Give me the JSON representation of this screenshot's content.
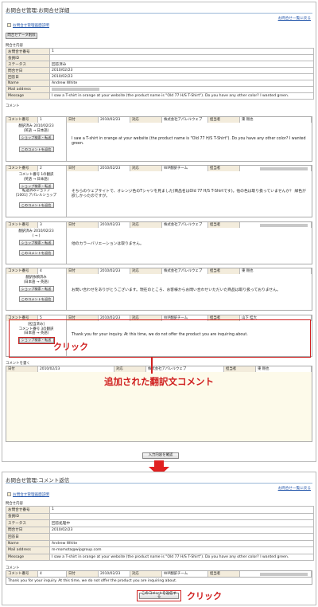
{
  "detail": {
    "title": "お問合せ管理:お問合せ詳細",
    "back_link": "お問合せ一覧に戻る",
    "help_link": "お問合せ管理画面説明",
    "data_button": "問合せデータ削除",
    "section_label": "問合せ内容",
    "fields": [
      {
        "key": "お問合せ番号",
        "value": "1"
      },
      {
        "key": "会員ID",
        "value": ""
      },
      {
        "key": "ステータス",
        "value": "回答済み"
      },
      {
        "key": "問合せ日",
        "value": "2010/02/23"
      },
      {
        "key": "回答日",
        "value": "2010/02/23"
      },
      {
        "key": "Name",
        "value": "Andrew White"
      },
      {
        "key": "Mail address",
        "value": ""
      },
      {
        "key": "Message",
        "value": "I saw a T-shirt in orange at your website (the product name is \"Old 77 H/S T-Shirt\"). Do you have any other color? I wanted green."
      }
    ],
    "comment_label": "コメント",
    "head_labels": {
      "num": "コメント番号",
      "date": "日付",
      "handler": "対応",
      "person": "担当者"
    },
    "comments": [
      {
        "num": "1",
        "date": "2010/02/23",
        "handler": "株式会社アパレルウェブ",
        "person": "東 剛也",
        "left": [
          "翻訳済み 2010/02/23",
          "(英語 → 日本語)"
        ],
        "buttons": [
          "ショップ検索・転送",
          "このコメントを返信"
        ],
        "body": "I saw a T-shirt in orange at your website (the product name is \"Old 77 H/S T-Shirt\"). Do you have any other color? I wanted green."
      },
      {
        "num": "2",
        "date": "2010/02/23",
        "handler": "WIP翻訳チーム",
        "person": "",
        "left": [
          "コメント番号 1の翻訳",
          "(英語 → 日本語)"
        ],
        "buttons": [
          "ショップ検索・転送"
        ],
        "extra": [
          "転送済みショップ",
          "[1001] アパレルショップ"
        ],
        "buttons2": [
          "このコメントを返信"
        ],
        "body": "そちらのウェブサイトで、オレンジ色のTシャツを見ました(商品名はOld 77 H/S T-Shirtです)。他の色は取り扱っていませんか？ 緑色が欲しかったのですが。"
      },
      {
        "num": "3",
        "date": "2010/02/23",
        "handler": "株式会社アパレルウェブ",
        "person": "",
        "left": [
          "翻訳済み 2010/02/23",
          "( → )"
        ],
        "buttons": [
          "ショップ検索・転送",
          "このコメントを返信"
        ],
        "body": "他のカラーバリエーションは取りません。"
      },
      {
        "num": "4",
        "date": "2010/02/23",
        "handler": "株式会社アパレルウェブ",
        "person": "東 剛也",
        "left": [
          "翻訳依頼済み",
          "(日本語 → 英語)"
        ],
        "buttons": [
          "ショップ検索・転送",
          "このコメントを返信"
        ],
        "body": "お問い合わせをありがとうございます。現在のところ、お客様からお問い合わせいただいた商品は取り扱っておりません。"
      },
      {
        "num": "5",
        "date": "2010/02/23",
        "handler": "WIP翻訳チーム",
        "person": "山下 桂大",
        "left": [
          "[担当済み]",
          "コメント番号 3の翻訳",
          "(日本語 → 英語)"
        ],
        "buttons": [
          "ショップ検索・転送"
        ],
        "body": "Thank you for your inquiry. At this time, we do not offer the product you are inquiring about."
      }
    ],
    "new_comment_label": "コメントを書く",
    "new_comment": {
      "date": "2010/02/23",
      "handler": "株式会社アパレルウェブ",
      "person": "東 剛也"
    },
    "confirm_button": "入力内容を確認"
  },
  "annotations": {
    "click1": "クリック",
    "added": "追加された翻訳文コメント",
    "click2": "クリック",
    "accent_color": "#d02020"
  },
  "reply": {
    "title": "お問合せ管理:コメント返信",
    "back_link": "お問合せ一覧に戻る",
    "help_link": "お問合せ管理画面説明",
    "section_label": "問合せ内容",
    "fields": [
      {
        "key": "お問合せ番号",
        "value": "1"
      },
      {
        "key": "会員ID",
        "value": ""
      },
      {
        "key": "ステータス",
        "value": "回答処理中"
      },
      {
        "key": "問合せ日",
        "value": "2010/02/23"
      },
      {
        "key": "回答日",
        "value": ""
      },
      {
        "key": "Name",
        "value": "Andrew White"
      },
      {
        "key": "Mail address",
        "value": "m-momota@wipgroup.com"
      },
      {
        "key": "Message",
        "value": "I saw a T-shirt in orange at your website (the product name is \"Old 77 H/S T-Shirt\"). Do you have any other color? I wanted green."
      }
    ],
    "comment_label": "コメント",
    "comment": {
      "num": "4",
      "date": "2010/02/23",
      "handler": "WIP翻訳チーム",
      "person": ""
    },
    "response": "Thank you for your inquiry. At this time, we do not offer the product you are inquiring about.",
    "submit_button": "このコメントを返信する"
  }
}
